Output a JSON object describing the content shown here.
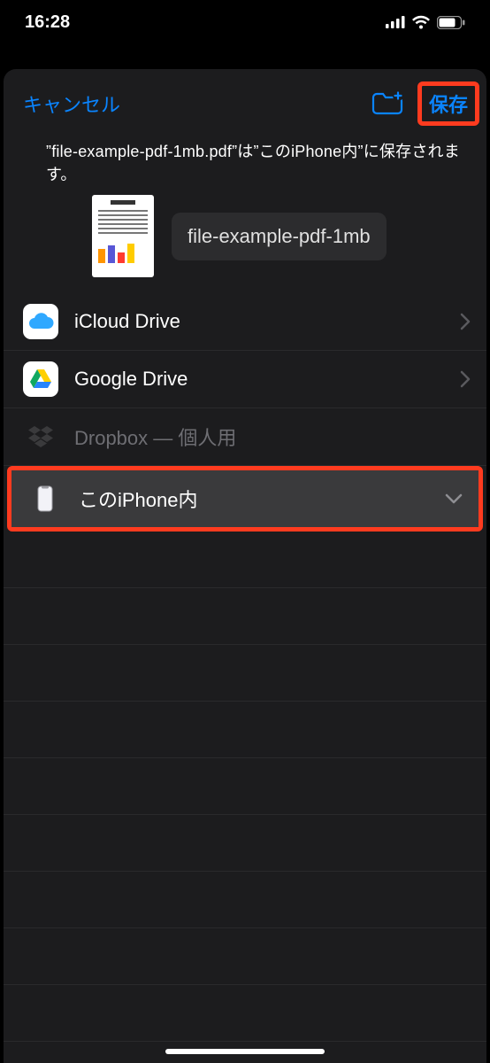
{
  "status": {
    "time": "16:28"
  },
  "header": {
    "cancel": "キャンセル",
    "save": "保存"
  },
  "info_text": "”file-example-pdf-1mb.pdf”は”このiPhone内”に保存されます。",
  "file": {
    "name": "file-example-pdf-1mb"
  },
  "locations": {
    "icloud": "iCloud Drive",
    "gdrive": "Google Drive",
    "dropbox": "Dropbox — 個人用",
    "iphone": "このiPhone内"
  }
}
